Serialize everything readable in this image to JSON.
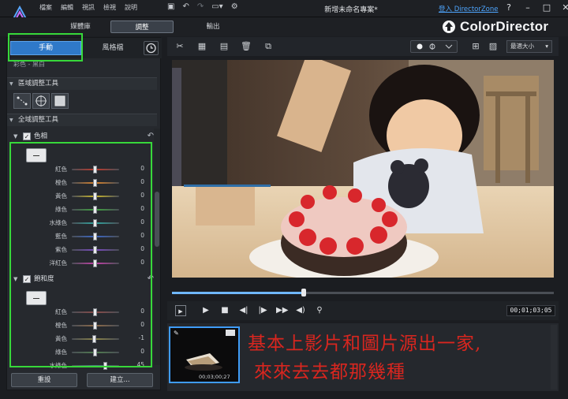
{
  "titlebar": {
    "menu": [
      "檔案",
      "編輯",
      "視訊",
      "檢視",
      "說明"
    ],
    "project_title": "新增未命名專案*",
    "login_link": "登入 DirectorZone",
    "help": "?",
    "minimize": "–",
    "maximize": "□",
    "close": "✕"
  },
  "modes": {
    "library": "媒體庫",
    "adjust": "調整",
    "output": "輸出"
  },
  "brand": {
    "name": "ColorDirector"
  },
  "left_panel": {
    "tab_manual": "手動",
    "tab_style": "風格檔",
    "breadcrumb": "彩色 - 黑白",
    "region_tools": "區域調整工具",
    "global_tools": "全域調整工具",
    "hue_group": {
      "title": "色相",
      "sliders": [
        {
          "label": "紅色",
          "value": "0",
          "pos": 0.5,
          "color": "#c0392b"
        },
        {
          "label": "橙色",
          "value": "0",
          "pos": 0.5,
          "color": "#d9822b"
        },
        {
          "label": "黃色",
          "value": "0",
          "pos": 0.5,
          "color": "#c9b62b"
        },
        {
          "label": "綠色",
          "value": "0",
          "pos": 0.5,
          "color": "#3fa33f"
        },
        {
          "label": "水綠色",
          "value": "0",
          "pos": 0.5,
          "color": "#2fa5a0"
        },
        {
          "label": "藍色",
          "value": "0",
          "pos": 0.5,
          "color": "#3a66c7"
        },
        {
          "label": "紫色",
          "value": "0",
          "pos": 0.5,
          "color": "#7b4bc4"
        },
        {
          "label": "洋紅色",
          "value": "0",
          "pos": 0.5,
          "color": "#c23fa8"
        }
      ]
    },
    "saturation_group": {
      "title": "飽和度",
      "sliders": [
        {
          "label": "紅色",
          "value": "0",
          "pos": 0.5,
          "color": "#8a4a48"
        },
        {
          "label": "橙色",
          "value": "0",
          "pos": 0.5,
          "color": "#8d6a48"
        },
        {
          "label": "黃色",
          "value": "-1",
          "pos": 0.49,
          "color": "#8a8348"
        },
        {
          "label": "綠色",
          "value": "0",
          "pos": 0.5,
          "color": "#4f7d4f"
        },
        {
          "label": "水綠色",
          "value": "45",
          "pos": 0.72,
          "color": "#4b7f7d"
        }
      ]
    },
    "reset_button": "重設",
    "create_button": "建立..."
  },
  "toolbar": {
    "fit_select": "最適大小"
  },
  "player": {
    "progress": 0.345,
    "timecode": "00;01;03;05"
  },
  "filmstrip": {
    "clip_time": "00;03;00;27",
    "annotation_line1": "基本上影片和圖片源出一家,",
    "annotation_line2": "來來去去都那幾種"
  },
  "colors": {
    "accent": "#2f79c9",
    "highlight": "#37d83a",
    "annotation": "#d9261f"
  }
}
